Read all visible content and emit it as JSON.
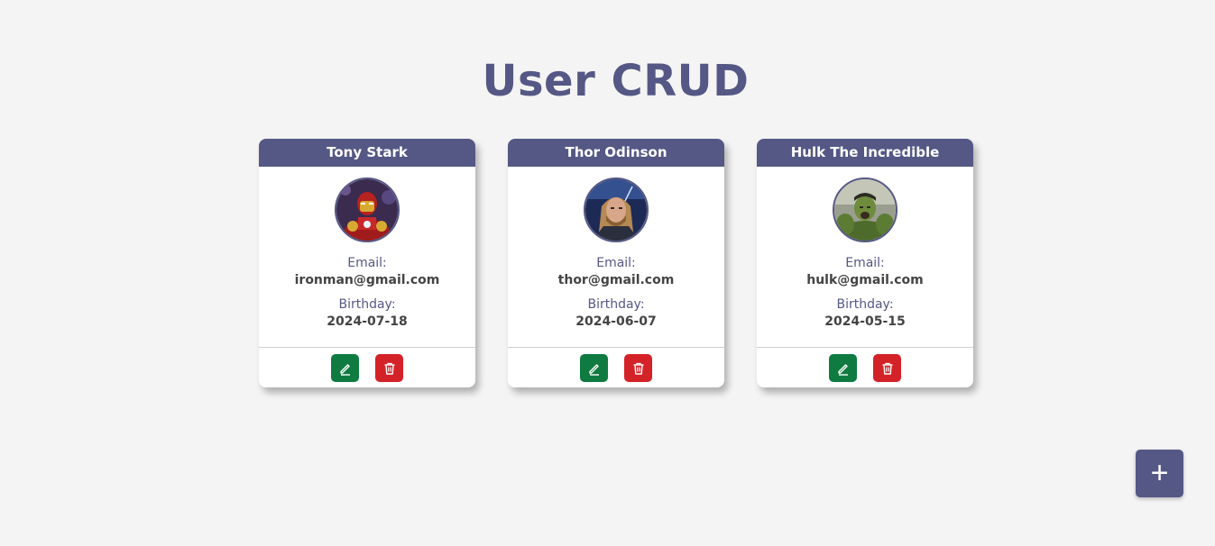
{
  "page": {
    "title": "User CRUD"
  },
  "labels": {
    "email": "Email:",
    "birthday": "Birthday:"
  },
  "users": [
    {
      "name": "Tony Stark",
      "email": "ironman@gmail.com",
      "birthday": "2024-07-18",
      "avatar": "iron-man-photo"
    },
    {
      "name": "Thor Odinson",
      "email": "thor@gmail.com",
      "birthday": "2024-06-07",
      "avatar": "thor-photo"
    },
    {
      "name": "Hulk The Incredible",
      "email": "hulk@gmail.com",
      "birthday": "2024-05-15",
      "avatar": "hulk-photo"
    }
  ],
  "actions": {
    "edit_icon": "pencil-icon",
    "delete_icon": "trash-icon",
    "add_label": "+"
  },
  "colors": {
    "accent": "#555885",
    "edit": "#0f7b41",
    "delete": "#d42328",
    "background": "#f4f4f4"
  }
}
